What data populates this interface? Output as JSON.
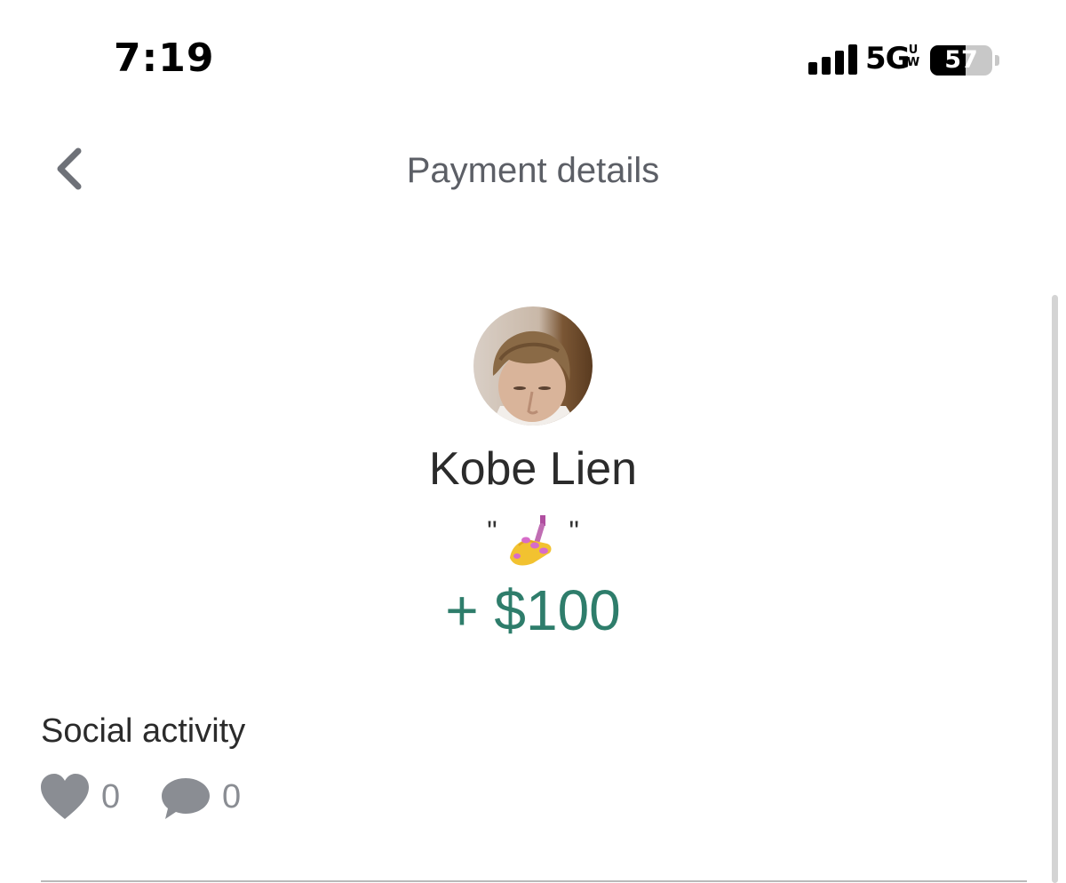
{
  "status_bar": {
    "time": "7:19",
    "network": "5G",
    "network_sup": "UW",
    "battery_level": 57,
    "battery_text": "57"
  },
  "header": {
    "title": "Payment details",
    "back_icon": "chevron-left-icon"
  },
  "payment": {
    "user_name": "Kobe Lien",
    "note_open_quote": "\"",
    "note_emoji": "nail-polish-emoji",
    "note_close_quote": "\"",
    "amount": "+ $100"
  },
  "social": {
    "title": "Social activity",
    "likes": "0",
    "comments": "0",
    "like_icon": "heart-icon",
    "comment_icon": "comment-icon"
  },
  "colors": {
    "amount": "#2e7d6b",
    "title": "#5c5f66",
    "icon": "#8a8d93"
  }
}
